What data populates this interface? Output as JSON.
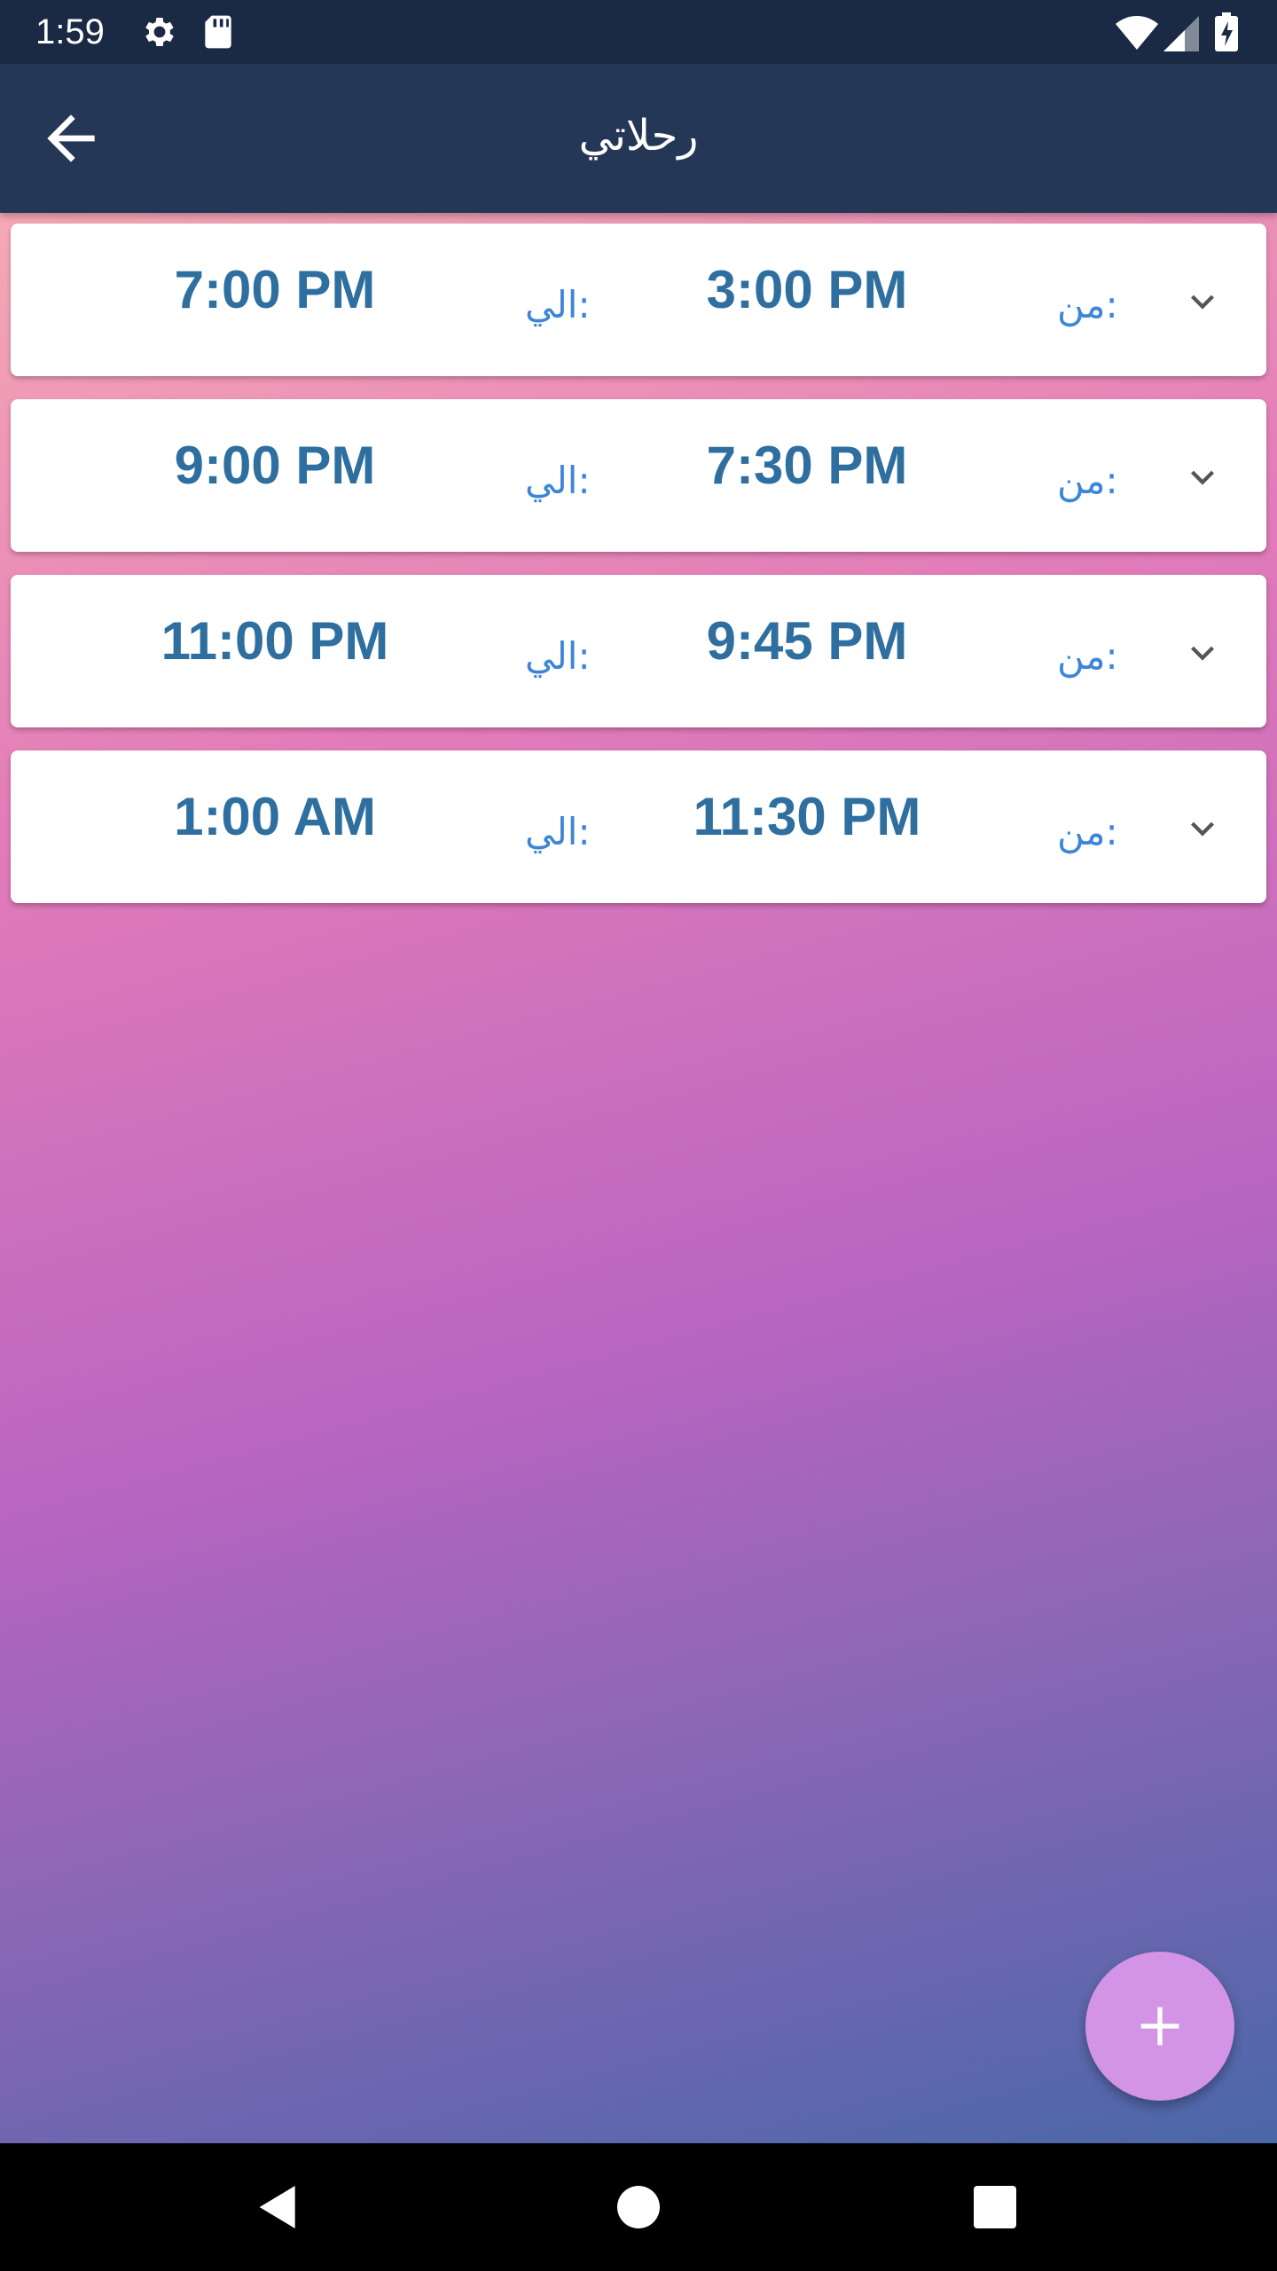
{
  "status_bar": {
    "time": "1:59",
    "icons": [
      "gear-icon",
      "sd-card-icon",
      "wifi-icon",
      "signal-icon",
      "battery-charging-icon"
    ]
  },
  "app_bar": {
    "title": "رحلاتي",
    "back_icon": "arrow-back-icon"
  },
  "trips": [
    {
      "from_label": "من:",
      "from_time": "3:00 PM",
      "to_label": "الي:",
      "to_time": "7:00 PM"
    },
    {
      "from_label": "من:",
      "from_time": "7:30 PM",
      "to_label": "الي:",
      "to_time": "9:00 PM"
    },
    {
      "from_label": "من:",
      "from_time": "9:45 PM",
      "to_label": "الي:",
      "to_time": "11:00 PM"
    },
    {
      "from_label": "من:",
      "from_time": "11:30 PM",
      "to_label": "الي:",
      "to_time": "1:00 AM"
    }
  ],
  "fab": {
    "icon": "plus-icon"
  },
  "nav_bar": {
    "icons": [
      "nav-back-icon",
      "nav-home-icon",
      "nav-recents-icon"
    ]
  },
  "colors": {
    "app_bar": "#243756",
    "status_bar": "#1b2a44",
    "time_text": "#2f6f9f",
    "label_text": "#3d86d6",
    "fab": "#d494e6"
  }
}
